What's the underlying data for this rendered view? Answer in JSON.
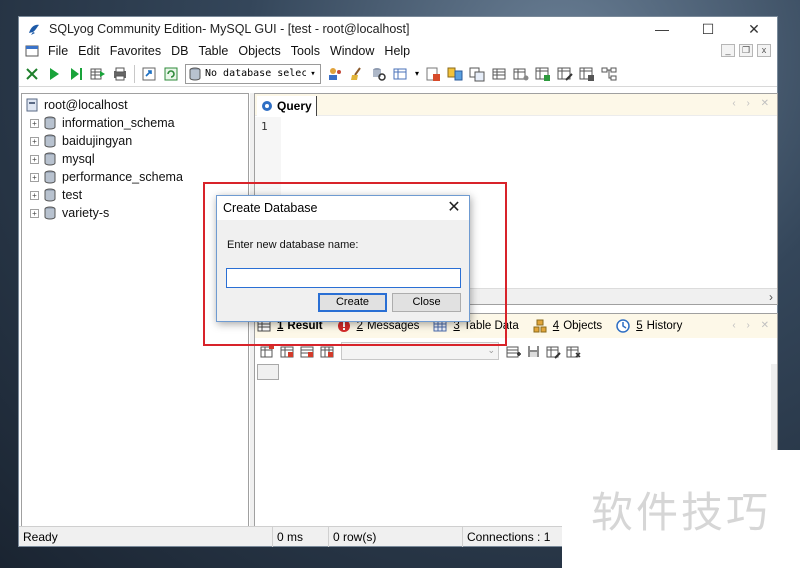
{
  "window": {
    "title": "SQLyog Community Edition- MySQL GUI - [test - root@localhost]",
    "minimize_glyph": "—",
    "maximize_glyph": "☐",
    "close_glyph": "✕"
  },
  "menu": {
    "items": [
      "File",
      "Edit",
      "Favorites",
      "DB",
      "Table",
      "Objects",
      "Tools",
      "Window",
      "Help"
    ]
  },
  "toolbar": {
    "database_select": "No database select",
    "dropdown_glyph": "▾"
  },
  "object_browser": {
    "root": "root@localhost",
    "expand_glyph": "+",
    "databases": [
      "information_schema",
      "baidujingyan",
      "mysql",
      "performance_schema",
      "test",
      "variety-s"
    ]
  },
  "query_editor": {
    "tab_label": "Query",
    "line_numbers": [
      "1"
    ],
    "tab_controls": "‹ › ✕",
    "scroll_right_glyph": "›"
  },
  "result_tabs": {
    "tabs": [
      {
        "num": "1",
        "label": "Result",
        "icon": "result-grid-icon",
        "active": true
      },
      {
        "num": "2",
        "label": "Messages",
        "icon": "messages-error-icon",
        "active": false
      },
      {
        "num": "3",
        "label": "Table Data",
        "icon": "table-data-icon",
        "active": false
      },
      {
        "num": "4",
        "label": "Objects",
        "icon": "objects-icon",
        "active": false
      },
      {
        "num": "5",
        "label": "History",
        "icon": "history-icon",
        "active": false
      }
    ],
    "tab_controls": "‹ › ✕",
    "combo_arrow": "⌄"
  },
  "statusbar": {
    "status": "Ready",
    "time": "0 ms",
    "rows": "0 row(s)",
    "connections": "Connections : 1"
  },
  "dialog": {
    "title": "Create Database",
    "prompt": "Enter new database name:",
    "input_value": "",
    "create_label": "Create",
    "close_label": "Close",
    "close_glyph": "✕"
  },
  "watermark": {
    "text": "软件技巧"
  },
  "colors": {
    "highlight_border": "#d8232a",
    "accent_blue": "#2a6fd4",
    "tab_background": "#fdf8e8"
  }
}
